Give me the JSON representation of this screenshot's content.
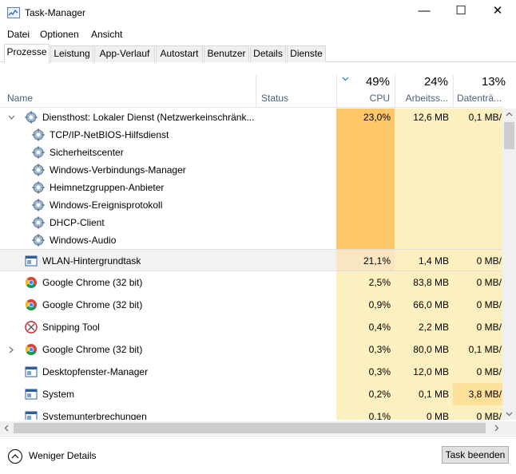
{
  "window": {
    "title": "Task-Manager",
    "minimize_glyph": "—",
    "maximize_glyph": "☐",
    "close_glyph": "✕"
  },
  "menu": [
    "Datei",
    "Optionen",
    "Ansicht"
  ],
  "tabs": [
    "Prozesse",
    "Leistung",
    "App-Verlauf",
    "Autostart",
    "Benutzer",
    "Details",
    "Dienste"
  ],
  "header": {
    "name": "Name",
    "status": "Status",
    "cpu": {
      "pct": "49%",
      "label": "CPU"
    },
    "mem": {
      "pct": "24%",
      "label": "Arbeitss..."
    },
    "disk": {
      "pct": "13%",
      "label": "Datenträ..."
    }
  },
  "rows": [
    {
      "name": "Diensthost: Lokaler Dienst (Netzwerkeinschränk...",
      "icon": "gear-icon",
      "expand": "expanded",
      "indent": 0,
      "cpu": "23,0%",
      "mem": "12,6 MB",
      "disk": "0,1 MB/"
    },
    {
      "name": "TCP/IP-NetBIOS-Hilfsdienst",
      "icon": "gear-icon",
      "indent": 1,
      "cpu": "",
      "mem": "",
      "disk": ""
    },
    {
      "name": "Sicherheitscenter",
      "icon": "gear-icon",
      "indent": 1,
      "cpu": "",
      "mem": "",
      "disk": ""
    },
    {
      "name": "Windows-Verbindungs-Manager",
      "icon": "gear-icon",
      "indent": 1,
      "cpu": "",
      "mem": "",
      "disk": ""
    },
    {
      "name": "Heimnetzgruppen-Anbieter",
      "icon": "gear-icon",
      "indent": 1,
      "cpu": "",
      "mem": "",
      "disk": ""
    },
    {
      "name": "Windows-Ereignisprotokoll",
      "icon": "gear-icon",
      "indent": 1,
      "cpu": "",
      "mem": "",
      "disk": ""
    },
    {
      "name": "DHCP-Client",
      "icon": "gear-icon",
      "indent": 1,
      "cpu": "",
      "mem": "",
      "disk": ""
    },
    {
      "name": "Windows-Audio",
      "icon": "gear-icon",
      "indent": 1,
      "cpu": "",
      "mem": "",
      "disk": ""
    },
    {
      "name": "WLAN-Hintergrundtask",
      "icon": "window-icon",
      "indent": 0,
      "cpu": "21,1%",
      "mem": "1,4 MB",
      "disk": "0 MB/"
    },
    {
      "name": "Google Chrome (32 bit)",
      "icon": "chrome-icon",
      "indent": 0,
      "cpu": "2,5%",
      "mem": "83,8 MB",
      "disk": "0 MB/"
    },
    {
      "name": "Google Chrome (32 bit)",
      "icon": "chrome-icon",
      "indent": 0,
      "cpu": "0,9%",
      "mem": "66,0 MB",
      "disk": "0 MB/"
    },
    {
      "name": "Snipping Tool",
      "icon": "scissors-icon",
      "indent": 0,
      "cpu": "0,4%",
      "mem": "2,2 MB",
      "disk": "0 MB/"
    },
    {
      "name": "Google Chrome (32 bit)",
      "icon": "chrome-icon",
      "expand": "collapsed",
      "indent": 0,
      "cpu": "0,3%",
      "mem": "80,0 MB",
      "disk": "0,1 MB/"
    },
    {
      "name": "Desktopfenster-Manager",
      "icon": "window-icon",
      "indent": 0,
      "cpu": "0,3%",
      "mem": "12,0 MB",
      "disk": "0 MB/"
    },
    {
      "name": "System",
      "icon": "window-icon",
      "indent": 0,
      "cpu": "0,2%",
      "mem": "0,1 MB",
      "disk": "3,8 MB/"
    },
    {
      "name": "Systemunterbrechungen",
      "icon": "window-icon",
      "indent": 0,
      "cpu": "0,1%",
      "mem": "0 MB",
      "disk": "0 MB/"
    }
  ],
  "colors": {
    "cpu_high": "#fdc76a",
    "cpu_mid": "#fbe3aa",
    "heat_low": "#fcefc0",
    "disk_hot": "#fde09a",
    "selected_row": "#f2f2f2",
    "accent": "#1979ca"
  },
  "footer": {
    "less_details": "Weniger Details",
    "end_task": "Task beenden"
  }
}
